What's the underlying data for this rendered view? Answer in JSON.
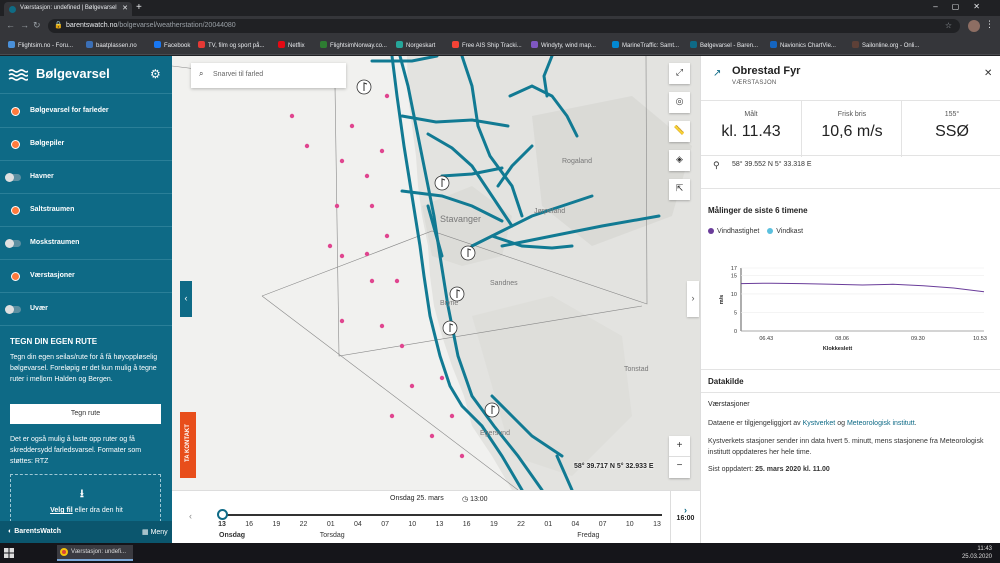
{
  "browser": {
    "tab_title": "Værstasjon: undefined | Bølgevarsel",
    "url_host": "barentswatch.no",
    "url_path": "/bolgevarsel/weatherstation/20044080",
    "bookmarks": [
      "Flightsim.no - Foru...",
      "baatplassen.no",
      "Facebook",
      "TV, film og sport på...",
      "Netflix",
      "FlightsimNorway.co...",
      "Norgeskart",
      "Free AIS Ship Tracki...",
      "Windyty, wind map...",
      "MarineTraffic: Samt...",
      "Bølgevarsel - Baren...",
      "Navionics ChartVie...",
      "Sailonline.org - Onli..."
    ]
  },
  "sidebar": {
    "title": "Bølgevarsel",
    "layers": [
      {
        "label": "Bølgevarsel for farleder",
        "control": "dot"
      },
      {
        "label": "Bølgepiler",
        "control": "dot"
      },
      {
        "label": "Havner",
        "control": "toggle"
      },
      {
        "label": "Saltstraumen",
        "control": "dot"
      },
      {
        "label": "Moskstraumen",
        "control": "toggle"
      },
      {
        "label": "Værstasjoner",
        "control": "dot"
      },
      {
        "label": "Uvær",
        "control": "toggle"
      }
    ],
    "route": {
      "title": "TEGN DIN EGEN RUTE",
      "text": "Tegn din egen seilas/rute for å få høyoppløselig bølgevarsel. Foreløpig er det kun mulig å tegne ruter i mellom Halden og Bergen.",
      "button": "Tegn rute",
      "text2": "Det er også mulig å laste opp ruter og få skreddersydd farledsvarsel. Formater som støttes: RTZ",
      "drop_link": "Velg fil",
      "drop_rest": " eller dra den hit"
    },
    "footer_logo": "BarentsWatch",
    "footer_menu": "Meny"
  },
  "map": {
    "search_placeholder": "Snarvei til farled",
    "contact": "TA KONTAKT",
    "coord_label": "58° 39.717 N 5° 32.933 E",
    "places": [
      "Rogaland",
      "Jørpeland",
      "Stavanger",
      "Sandnes",
      "Bryne",
      "Egersund",
      "Tonstad"
    ]
  },
  "timeline": {
    "date": "Onsdag 25. mars",
    "time": "13:00",
    "ticks": [
      "13",
      "16",
      "19",
      "22",
      "01",
      "04",
      "07",
      "10",
      "13",
      "16",
      "19",
      "22",
      "01",
      "04",
      "07",
      "10",
      "13"
    ],
    "days": [
      "Onsdag",
      "Torsdag",
      "Fredag"
    ],
    "next": "16:00"
  },
  "panel": {
    "title": "Obrestad Fyr",
    "subtitle": "VÆRSTASJON",
    "metrics": [
      {
        "label": "Målt",
        "value": "kl. 11.43"
      },
      {
        "label": "Frisk bris",
        "value": "10,6 m/s"
      },
      {
        "label": "155°",
        "value": "SSØ"
      }
    ],
    "coords": "58° 39.552 N 5° 33.318 E",
    "chart_heading": "Målinger de siste 6 timene",
    "legend": [
      {
        "name": "Vindhastighet",
        "color": "#6a3d9a"
      },
      {
        "name": "Vindkast",
        "color": "#5bc0de"
      }
    ],
    "datasource_title": "Datakilde",
    "datasource_sub": "Værstasjoner",
    "ds_p1_pre": "Dataene er tilgjengeliggjort av ",
    "ds_link1": "Kystverket",
    "ds_and": " og ",
    "ds_link2": "Meteorologisk institutt",
    "ds_end": ".",
    "ds_p2": "Kystverkets stasjoner sender inn data hvert 5. minutt, mens stasjonene fra Meteorologisk institutt oppdateres her hele time.",
    "ds_p3_pre": "Sist oppdatert: ",
    "ds_p3_bold": "25. mars 2020 kl. 11.00"
  },
  "chart_data": {
    "type": "line",
    "title": "",
    "xlabel": "Klokkeslett",
    "ylabel": "m/s",
    "x_ticks": [
      "06.43",
      "08.06",
      "09.30",
      "10.53"
    ],
    "y_ticks": [
      0,
      5,
      10,
      15,
      17
    ],
    "ylim": [
      0,
      17
    ],
    "x": [
      0,
      1,
      2,
      3,
      4,
      5,
      6,
      7,
      8
    ],
    "series": [
      {
        "name": "Vindhastighet",
        "values": [
          12.8,
          12.9,
          12.8,
          12.6,
          12.4,
          12.6,
          12.2,
          11.6,
          10.6
        ]
      }
    ]
  },
  "taskbar": {
    "app": "Værstasjon: undefi...",
    "time": "11:43",
    "date": "25.03.2020"
  },
  "colors": {
    "brand": "#0e6a86",
    "accent": "#ff7a3d",
    "contact": "#e84e1b"
  }
}
